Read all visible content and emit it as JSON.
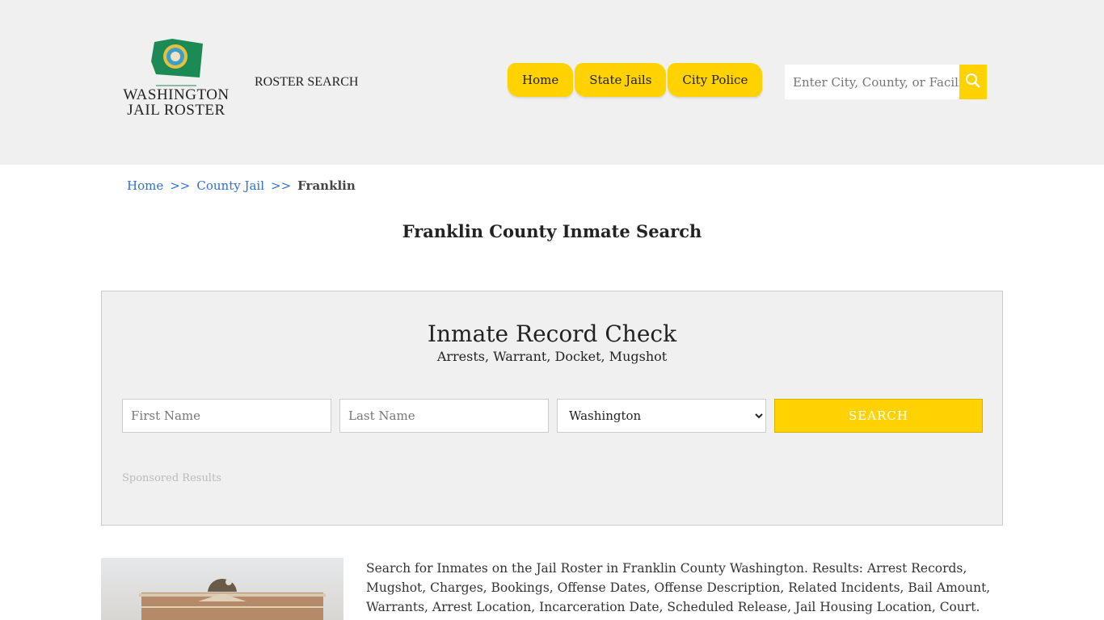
{
  "header": {
    "logo_line1": "WASHINGTON",
    "logo_line2": "JAIL ROSTER",
    "roster_search": "ROSTER SEARCH",
    "nav": [
      "Home",
      "State Jails",
      "City Police"
    ],
    "search_placeholder": "Enter City, County, or Facility"
  },
  "breadcrumb": {
    "items": [
      "Home",
      "County Jail"
    ],
    "sep": ">>",
    "current": "Franklin"
  },
  "page_title": "Franklin County Inmate Search",
  "form": {
    "title": "Inmate Record Check",
    "subtitle": "Arrests, Warrant, Docket, Mugshot",
    "first_placeholder": "First Name",
    "last_placeholder": "Last Name",
    "state": "Washington",
    "button": "SEARCH",
    "sponsored": "Sponsored Results"
  },
  "description": "Search for Inmates on the Jail Roster in Franklin County Washington. Results: Arrest Records, Mugshot, Charges, Bookings, Offense Dates, Offense Description, Related Incidents, Bail Amount, Warrants, Arrest Location, Incarceration Date, Scheduled Release, Jail Housing Location, Court.",
  "colors": {
    "accent": "#ffd200",
    "link": "#2f6fd6",
    "header_bg": "#f0f0f0"
  }
}
